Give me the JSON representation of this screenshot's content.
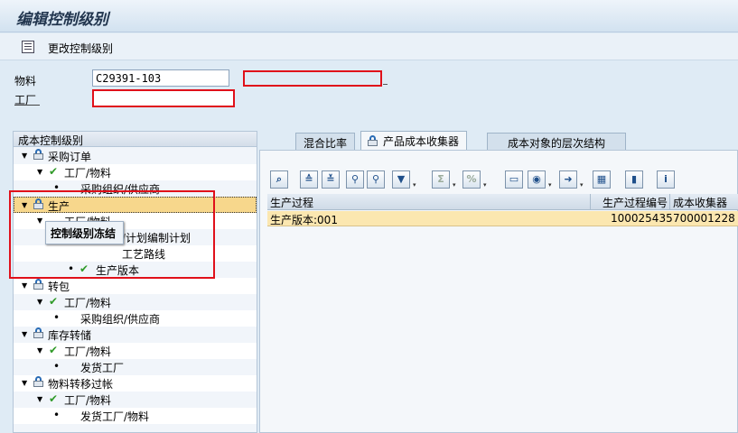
{
  "title": "编辑控制级别",
  "toolbar": {
    "change_label": "更改控制级别"
  },
  "fields": {
    "material_label": "物料",
    "material_value": "C29391-103",
    "material_text": "",
    "plant_label": "工厂",
    "plant_value": ""
  },
  "tree": {
    "header": "成本控制级别",
    "rows": [
      "采购订单",
      "工厂/物料",
      "采购组织/供应商",
      "生产",
      "工厂/物料",
      "/计划编制计划",
      "工艺路线",
      "生产版本",
      "转包",
      "工厂/物料",
      "采购组织/供应商",
      "库存转储",
      "工厂/物料",
      "发货工厂",
      "物料转移过帐",
      "工厂/物料",
      "发货工厂/物料"
    ],
    "tooltip": "控制级别冻结"
  },
  "tabs": [
    "混合比率",
    "产品成本收集器",
    "成本对象的层次结构"
  ],
  "grid": {
    "columns": [
      "生产过程",
      "生产过程编号",
      "成本收集器"
    ],
    "rows": [
      [
        "生产版本:001",
        "100025435",
        "700001228"
      ]
    ]
  },
  "colors": {
    "highlight_red": "#e0101a",
    "check_green": "#2f9a28",
    "selection": "#f7d78c"
  },
  "icons": [
    "list-icon",
    "lock-icon",
    "check-icon",
    "expand-triangle-icon"
  ]
}
